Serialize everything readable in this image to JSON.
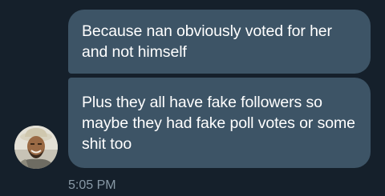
{
  "conversation": {
    "messages": [
      {
        "text": "Because nan obviously voted for her and not himself"
      },
      {
        "text": "Plus they all have fake followers so maybe they had fake poll votes or some shit too"
      }
    ],
    "timestamp": "5:05 PM"
  },
  "colors": {
    "background": "#15202b",
    "bubble": "#3d5466",
    "message_text": "#ffffff",
    "timestamp_text": "#8899a6"
  },
  "icons": {
    "avatar": "sender-avatar"
  }
}
